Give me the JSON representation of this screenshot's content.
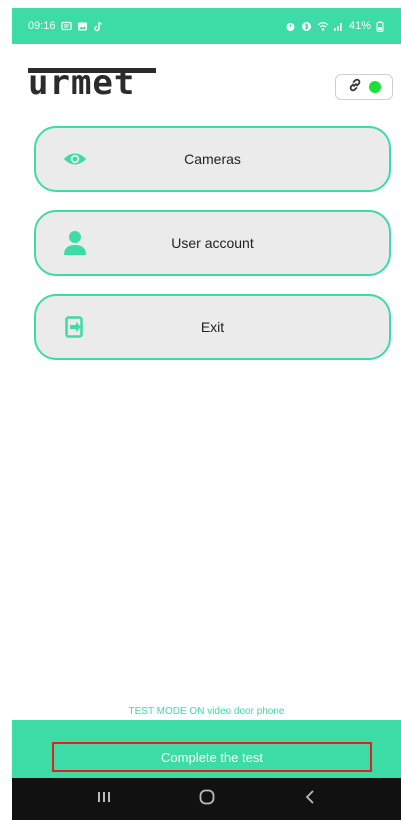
{
  "status_bar": {
    "time": "09:16",
    "battery_text": "41%",
    "left_icons": [
      "chat-icon",
      "image-icon",
      "tiktok-icon"
    ],
    "right_icons": [
      "alarm-icon",
      "bluetooth-icon",
      "wifi-icon",
      "signal-icon",
      "battery-icon"
    ]
  },
  "header": {
    "logo_text": "urmet",
    "connection": {
      "icon": "link-icon",
      "status_color": "#19e03b"
    }
  },
  "menu": {
    "items": [
      {
        "label": "Cameras",
        "icon": "eye-icon"
      },
      {
        "label": "User account",
        "icon": "user-icon"
      },
      {
        "label": "Exit",
        "icon": "exit-icon"
      }
    ]
  },
  "footer": {
    "test_mode_text": "TEST MODE ON video door phone",
    "complete_label": "Complete the test",
    "highlight_color": "#e02020"
  },
  "nav": {
    "buttons": [
      "recent-apps-icon",
      "home-icon",
      "back-icon"
    ]
  },
  "colors": {
    "accent": "#3ddba6",
    "button_bg": "#ebebeb",
    "nav_bg": "#111111"
  }
}
